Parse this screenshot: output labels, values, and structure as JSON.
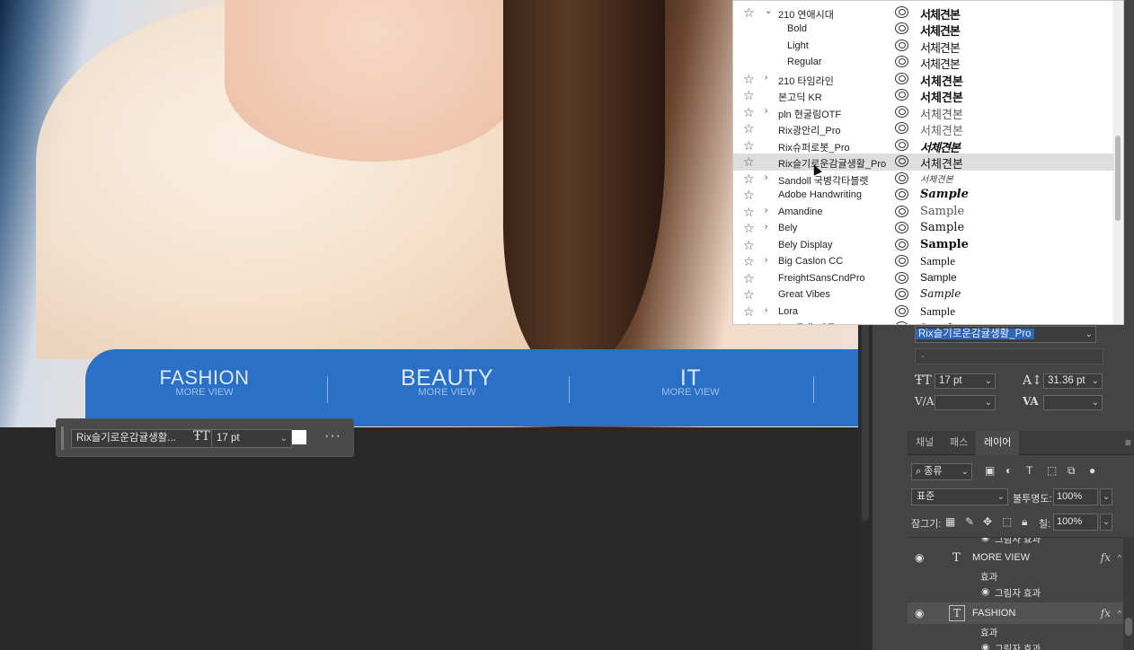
{
  "banner": {
    "items": [
      {
        "title": "FASHION",
        "sub": "MORE VIEW"
      },
      {
        "title": "BEAUTY",
        "sub": "MORE VIEW"
      },
      {
        "title": "IT",
        "sub": "MORE VIEW"
      }
    ]
  },
  "context_bar": {
    "font": "Rix슬기로운감귤생활...",
    "size": "17 pt",
    "more": "···",
    "swatch_color": "#ffffff"
  },
  "font_list": {
    "rows": [
      {
        "name": "210 연애시대",
        "sample": "서체견본",
        "star": true,
        "expander": "⌄"
      },
      {
        "name": "Bold",
        "sample": "서체견본",
        "star": false,
        "expander": "",
        "sub": true
      },
      {
        "name": "Light",
        "sample": "서체견본",
        "star": false,
        "expander": "",
        "sub": true
      },
      {
        "name": "Regular",
        "sample": "서체견본",
        "star": false,
        "expander": "",
        "sub": true
      },
      {
        "name": "210 타임라인",
        "sample": "서체견본",
        "star": true,
        "expander": "›"
      },
      {
        "name": "본고딕 KR",
        "sample": "서체견본",
        "star": true,
        "expander": ""
      },
      {
        "name": "pln 현굴림OTF",
        "sample": "서체견본",
        "star": true,
        "expander": "›"
      },
      {
        "name": "Rix광안리_Pro",
        "sample": "서체견본",
        "star": true,
        "expander": ""
      },
      {
        "name": "Rix슈퍼로봇_Pro",
        "sample": "서체견본",
        "star": true,
        "expander": ""
      },
      {
        "name": "Rix슬기로운감귤생활_Pro",
        "sample": "서체견본",
        "star": true,
        "expander": "",
        "hover": true
      },
      {
        "name": "Sandoll 국병각타블렛",
        "sample": "서체견본",
        "star": true,
        "expander": "›"
      },
      {
        "name": "Adobe Handwriting",
        "sample": "Sample",
        "star": true,
        "expander": ""
      },
      {
        "name": "Amandine",
        "sample": "Sample",
        "star": true,
        "expander": "›"
      },
      {
        "name": "Bely",
        "sample": "Sample",
        "star": true,
        "expander": "›"
      },
      {
        "name": "Bely Display",
        "sample": "Sample",
        "star": true,
        "expander": ""
      },
      {
        "name": "Big Caslon CC",
        "sample": "Sample",
        "star": true,
        "expander": "›"
      },
      {
        "name": "FreightSansCndPro",
        "sample": "Sample",
        "star": true,
        "expander": ""
      },
      {
        "name": "Great Vibes",
        "sample": "Sample",
        "star": true,
        "expander": ""
      },
      {
        "name": "Lora",
        "sample": "Sample",
        "star": true,
        "expander": "›"
      },
      {
        "name": "Los Feliz OT",
        "sample": "Sample",
        "star": true,
        "expander": "›"
      }
    ]
  },
  "character_panel": {
    "font_family": "Rix슬기로운감귤생활_Pro",
    "font_style": "-",
    "font_size": "17 pt",
    "leading": "31.36 pt",
    "kerning_label": "V/A",
    "kerning": "",
    "tracking_label": "VA",
    "tracking": ""
  },
  "layers_panel": {
    "tabs": [
      "채널",
      "패스",
      "레이어"
    ],
    "active_tab": "레이어",
    "filter_kind": "종류",
    "blend_mode": "표준",
    "opacity_label": "불투명도:",
    "opacity": "100%",
    "lock_label": "잠그기:",
    "fill_label": "칠:",
    "fill": "100%",
    "layers": [
      {
        "name": "그림자 효과",
        "kind": "effect-item"
      },
      {
        "name": "MORE VIEW",
        "kind": "text",
        "fx": "fx"
      },
      {
        "name": "효과",
        "kind": "effects"
      },
      {
        "name": "그림자 효과",
        "kind": "effect-item"
      },
      {
        "name": "FASHION",
        "kind": "text",
        "fx": "fx",
        "selected": true
      },
      {
        "name": "효과",
        "kind": "effects"
      },
      {
        "name": "그림자 효과",
        "kind": "effect-item"
      }
    ]
  },
  "colors": {
    "banner_blue": "#2a70c7",
    "selection_blue": "#2e65b6",
    "panel_bg": "#444444"
  }
}
